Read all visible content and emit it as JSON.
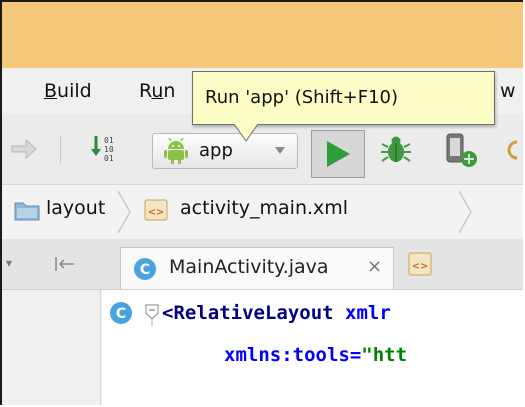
{
  "menu": {
    "build_label": "uild",
    "build_mnemonic": "B",
    "run_prefix": "R",
    "run_mnemonic": "u",
    "run_suffix": "n",
    "partial_label": "w"
  },
  "tooltip": {
    "text": "Run 'app' (Shift+F10)"
  },
  "toolbar": {
    "run_config_label": "app",
    "run_config_icon": "android-icon",
    "run_button_icon": "play-icon",
    "debug_icon": "bug-icon",
    "device_icon": "device-monitor-icon",
    "accent_green": "#2e9e3a"
  },
  "breadcrumb": {
    "items": [
      {
        "label": "layout",
        "icon": "folder-icon"
      },
      {
        "label": "activity_main.xml",
        "icon": "xml-file-icon"
      }
    ]
  },
  "tabs": {
    "active": {
      "label": "MainActivity.java",
      "icon": "class-icon",
      "close_glyph": "×"
    }
  },
  "editor": {
    "line1": {
      "tag": "<RelativeLayout",
      "attr_partial": "xmlr"
    },
    "line2": {
      "attr": "xmlns:tools=",
      "value_partial": "\"htt"
    }
  }
}
